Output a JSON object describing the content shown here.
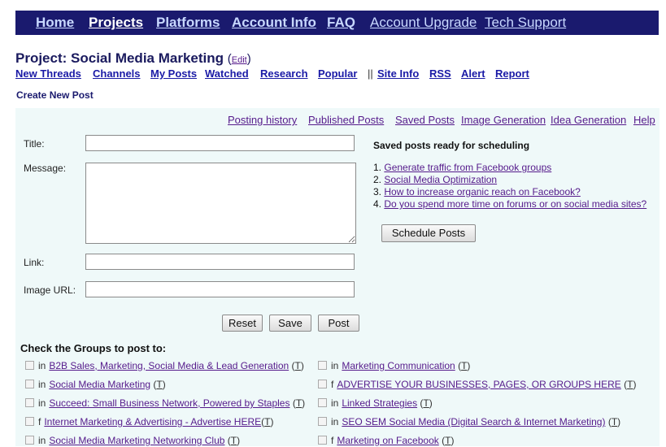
{
  "topnav": {
    "items": [
      "Home",
      "Projects",
      "Platforms",
      "Account Info",
      "FAQ",
      "Account Upgrade",
      "Tech Support"
    ]
  },
  "project": {
    "heading": "Project: Social Media Marketing",
    "edit_label": "Edit"
  },
  "subnav": {
    "items": [
      "New Threads",
      "Channels",
      "My Posts",
      "Watched",
      "Research",
      "Popular",
      "Site Info",
      "RSS",
      "Alert",
      "Report"
    ],
    "separator": "||"
  },
  "create_label": "Create New Post",
  "tabs": [
    "Posting history",
    "Published Posts",
    "Saved Posts",
    "Image Generation",
    "Idea Generation",
    "Help"
  ],
  "form": {
    "title_label": "Title:",
    "message_label": "Message:",
    "link_label": "Link:",
    "image_label": "Image URL:",
    "title_value": "",
    "message_value": "",
    "link_value": "",
    "image_value": "",
    "reset_label": "Reset",
    "save_label": "Save",
    "post_label": "Post"
  },
  "saved": {
    "title": "Saved posts ready for scheduling",
    "items": [
      {
        "num": "1.",
        "label": "Generate traffic from Facebook groups"
      },
      {
        "num": "2.",
        "label": "Social Media Optimization"
      },
      {
        "num": "3.",
        "label": "How to increase organic reach on Facebook?"
      },
      {
        "num": "4.",
        "label": "Do you spend more time on forums or on social media sites?"
      }
    ],
    "schedule_label": "Schedule Posts"
  },
  "groups": {
    "title": "Check the Groups to post to:",
    "t_label": "T",
    "left": [
      {
        "prefix": "in",
        "name": "B2B Sales, Marketing, Social Media & Lead Generation"
      },
      {
        "prefix": "in",
        "name": "Social Media Marketing"
      },
      {
        "prefix": "in",
        "name": "Succeed: Small Business Network, Powered by Staples"
      },
      {
        "prefix": "f",
        "name": "Internet Marketing & Advertising - Advertise HERE"
      },
      {
        "prefix": "in",
        "name": "Social Media Marketing Networking Club"
      }
    ],
    "right": [
      {
        "prefix": "in",
        "name": "Marketing Communication"
      },
      {
        "prefix": "f",
        "name": "ADVERTISE YOUR BUSINESSES, PAGES, OR GROUPS HERE"
      },
      {
        "prefix": "in",
        "name": "Linked Strategies"
      },
      {
        "prefix": "in",
        "name": "SEO SEM Social Media (Digital Search & Internet Marketing)"
      },
      {
        "prefix": "f",
        "name": "Marketing on Facebook"
      }
    ]
  },
  "colors": {
    "nav_bg": "#1a1a6e",
    "panel_bg": "#eff9f9",
    "visited_link": "#551a8b"
  }
}
